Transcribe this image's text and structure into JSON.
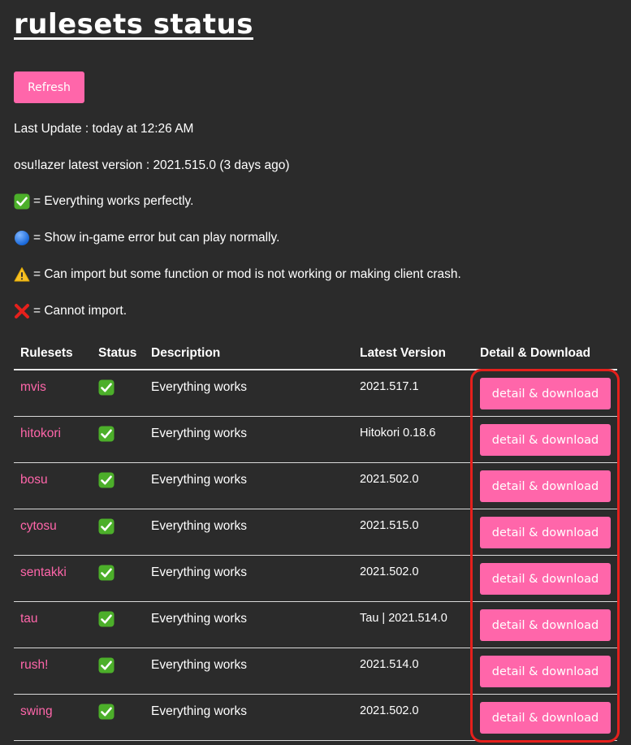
{
  "page": {
    "title": "rulesets status",
    "refresh_label": "Refresh",
    "last_update": "Last Update : today at 12:26 AM",
    "latest_version": "osu!lazer latest version : 2021.515.0 (3 days ago)"
  },
  "legend": [
    {
      "icon": "check-mark-icon",
      "text": "= Everything works perfectly."
    },
    {
      "icon": "blue-circle-icon",
      "text": "= Show in-game error but can play normally."
    },
    {
      "icon": "warning-icon",
      "text": "= Can import but some function or mod is not working or making client crash."
    },
    {
      "icon": "cross-mark-icon",
      "text": "= Cannot import."
    }
  ],
  "table": {
    "headers": [
      "Rulesets",
      "Status",
      "Description",
      "Latest Version",
      "Detail & Download"
    ],
    "rows": [
      {
        "name": "mvis",
        "status": "check-mark-icon",
        "description": "Everything works",
        "version": "2021.517.1",
        "button": "detail & download"
      },
      {
        "name": "hitokori",
        "status": "check-mark-icon",
        "description": "Everything works",
        "version": "Hitokori 0.18.6",
        "button": "detail & download"
      },
      {
        "name": "bosu",
        "status": "check-mark-icon",
        "description": "Everything works",
        "version": "2021.502.0",
        "button": "detail & download"
      },
      {
        "name": "cytosu",
        "status": "check-mark-icon",
        "description": "Everything works",
        "version": "2021.515.0",
        "button": "detail & download"
      },
      {
        "name": "sentakki",
        "status": "check-mark-icon",
        "description": "Everything works",
        "version": "2021.502.0",
        "button": "detail & download"
      },
      {
        "name": "tau",
        "status": "check-mark-icon",
        "description": "Everything works",
        "version": "Tau | 2021.514.0",
        "button": "detail & download"
      },
      {
        "name": "rush!",
        "status": "check-mark-icon",
        "description": "Everything works",
        "version": "2021.514.0",
        "button": "detail & download"
      },
      {
        "name": "swing",
        "status": "check-mark-icon",
        "description": "Everything works",
        "version": "2021.502.0",
        "button": "detail & download"
      }
    ]
  },
  "colors": {
    "background": "#2b2b2b",
    "accent": "#ff66aa",
    "highlight": "#e5201c",
    "check_green": "#4caf2a"
  }
}
